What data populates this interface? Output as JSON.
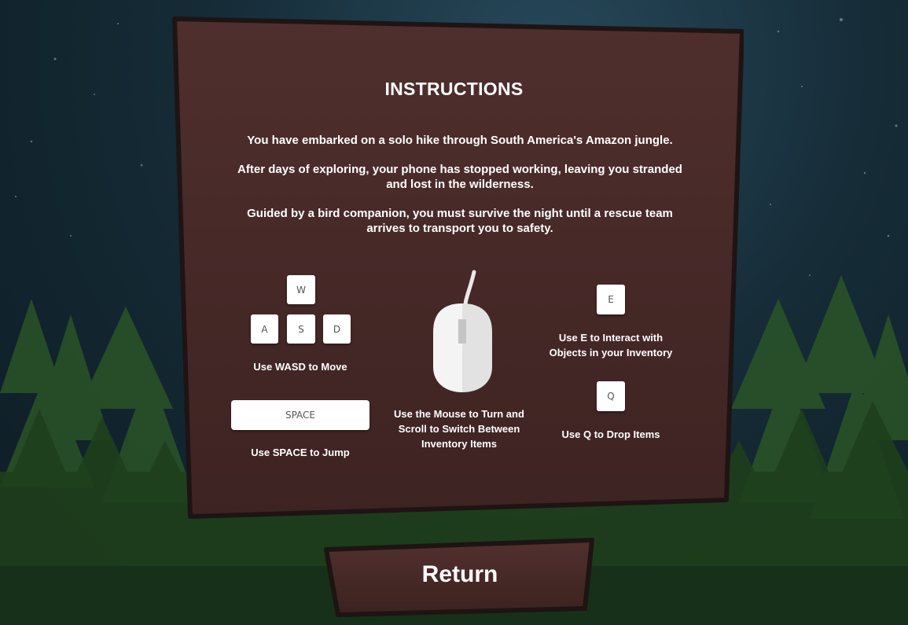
{
  "instructions": {
    "title": "INSTRUCTIONS",
    "paragraphs": [
      "You have embarked on a solo hike through South America's Amazon jungle.",
      "After days of exploring, your phone has stopped working, leaving you stranded and lost in the wilderness.",
      "Guided by a bird companion, you must survive the night until a rescue team arrives to transport you to safety."
    ]
  },
  "controls": {
    "keys": {
      "w": "W",
      "a": "A",
      "s": "S",
      "d": "D",
      "space": "SPACE",
      "e": "E",
      "q": "Q"
    },
    "move_label": "Use WASD to Move",
    "jump_label": "Use SPACE to Jump",
    "mouse_label": "Use the Mouse to Turn and Scroll to Switch Between Inventory Items",
    "interact_label": "Use E to Interact with Objects in your Inventory",
    "drop_label": "Use Q to Drop Items"
  },
  "return_button": {
    "label": "Return"
  },
  "colors": {
    "panel": "#4a2c2b",
    "panel_border": "#1e1413",
    "key_bg": "#ffffff",
    "text": "#ffffff"
  },
  "icons": [
    "mouse-icon"
  ]
}
